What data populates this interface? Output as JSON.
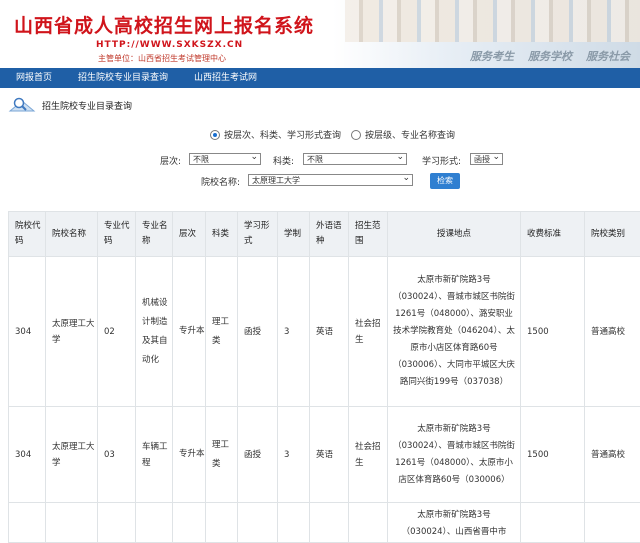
{
  "header": {
    "title": "山西省成人高校招生网上报名系统",
    "url": "HTTP://WWW.SXKSZX.CN",
    "sponsor": "主管单位：山西省招生考试管理中心",
    "slogans": [
      "服务考生",
      "服务学校",
      "服务社会"
    ]
  },
  "nav": {
    "items": [
      "网报首页",
      "招生院校专业目录查询",
      "山西招生考试网"
    ]
  },
  "breadcrumb": {
    "text": "招生院校专业目录查询"
  },
  "query_modes": {
    "options": [
      "按层次、科类、学习形式查询",
      "按层级、专业名称查询"
    ],
    "selected": 0
  },
  "filters": {
    "level_label": "层次:",
    "level_value": "不限",
    "category_label": "科类:",
    "category_value": "不限",
    "study_form_label": "学习形式:",
    "study_form_value": "函授",
    "school_label": "院校名称:",
    "school_value": "太原理工大学",
    "search_button": "检索"
  },
  "table": {
    "columns": [
      "院校代码",
      "院校名称",
      "专业代码",
      "专业名称",
      "层次",
      "科类",
      "学习形式",
      "学制",
      "外语语种",
      "招生范围",
      "授课地点",
      "收费标准",
      "院校类别"
    ],
    "rows": [
      {
        "school_code": "304",
        "school_name": "太原理工大学",
        "major_code": "02",
        "major_name": "机械设计制造及其自动化",
        "level": "专升本",
        "category": "理工类",
        "study_form": "函授",
        "duration": "3",
        "language": "英语",
        "scope": "社会招生",
        "location": "太原市新矿院路3号（030024）、晋城市城区书院街1261号（048000）、潞安职业技术学院教育处（046204）、太原市小店区体育路60号（030006）、大同市平城区大庆路同兴街199号（037038）",
        "fee": "1500",
        "school_type": "普通高校"
      },
      {
        "school_code": "304",
        "school_name": "太原理工大学",
        "major_code": "03",
        "major_name": "车辆工程",
        "level": "专升本",
        "category": "理工类",
        "study_form": "函授",
        "duration": "3",
        "language": "英语",
        "scope": "社会招生",
        "location": "太原市新矿院路3号（030024）、晋城市城区书院街1261号（048000）、太原市小店区体育路60号（030006）",
        "fee": "1500",
        "school_type": "普通高校"
      },
      {
        "school_code": "",
        "school_name": "",
        "major_code": "",
        "major_name": "",
        "level": "",
        "category": "",
        "study_form": "",
        "duration": "",
        "language": "",
        "scope": "",
        "location": "太原市新矿院路3号（030024）、山西省晋中市",
        "fee": "",
        "school_type": ""
      }
    ]
  }
}
